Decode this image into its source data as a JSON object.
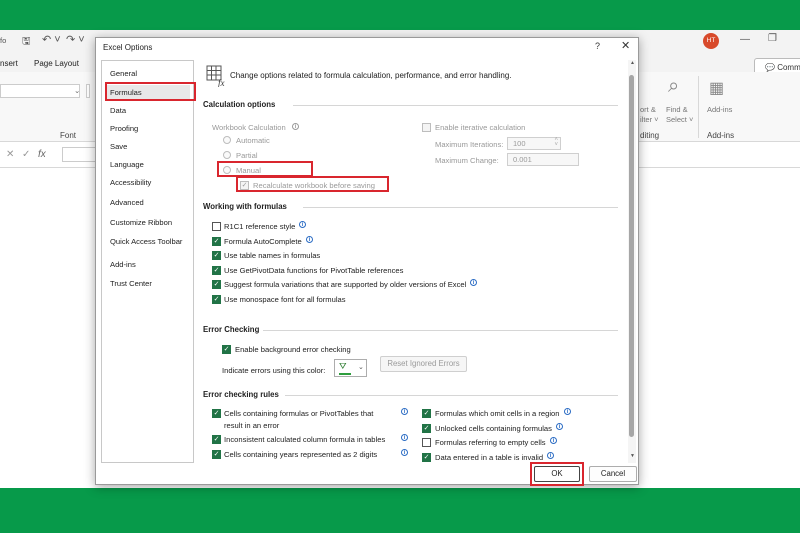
{
  "colors": {
    "band": "#079a4a",
    "highlight": "#d9262e",
    "check": "#217346",
    "avatar": "#d84a2b"
  },
  "excel": {
    "qat_left": "fo",
    "tabs": [
      "nsert",
      "Page Layout"
    ],
    "groups": {
      "font": "Font",
      "editing": "diting",
      "addins": "Add-ins"
    },
    "ribbon": {
      "sort1": "ort &",
      "sort2": "ilter",
      "find1": "Find &",
      "find2": "Select",
      "addins_btn": "Add-ins"
    },
    "avatar": "HT",
    "comments": "Comme",
    "fx": "fx"
  },
  "dialog": {
    "title": "Excel Options",
    "help": "?",
    "close": "✕",
    "nav": [
      "General",
      "Formulas",
      "Data",
      "Proofing",
      "Save",
      "Language",
      "Accessibility",
      "Advanced",
      "Customize Ribbon",
      "Quick Access Toolbar",
      "Add-ins",
      "Trust Center"
    ],
    "nav_selected": "Formulas",
    "header": "Change options related to formula calculation, performance, and error handling.",
    "calc": {
      "title": "Calculation options",
      "workbook_calc": "Workbook Calculation",
      "automatic": "Automatic",
      "partial": "Partial",
      "manual": "Manual",
      "recalc": "Recalculate workbook before saving",
      "iterative": "Enable iterative calculation",
      "max_iter_label": "Maximum Iterations:",
      "max_iter_value": "100",
      "max_change_label": "Maximum Change:",
      "max_change_value": "0.001"
    },
    "working": {
      "title": "Working with formulas",
      "items": [
        {
          "label": "R1C1 reference style",
          "checked": false,
          "info": true
        },
        {
          "label": "Formula AutoComplete",
          "checked": true,
          "info": true
        },
        {
          "label": "Use table names in formulas",
          "checked": true,
          "info": false
        },
        {
          "label": "Use GetPivotData functions for PivotTable references",
          "checked": true,
          "info": false
        },
        {
          "label": "Suggest formula variations that are supported by older versions of Excel",
          "checked": true,
          "info": true
        },
        {
          "label": "Use monospace font for all formulas",
          "checked": true,
          "info": false
        }
      ]
    },
    "error_checking": {
      "title": "Error Checking",
      "enable": "Enable background error checking",
      "indicate": "Indicate errors using this color:",
      "reset": "Reset Ignored Errors"
    },
    "rules": {
      "title": "Error checking rules",
      "left": [
        {
          "label": "Cells containing formulas or PivotTables that",
          "label2": "result in an error",
          "checked": true
        },
        {
          "label": "Inconsistent calculated column formula in tables",
          "checked": true
        },
        {
          "label": "Cells containing years represented as 2 digits",
          "checked": true
        }
      ],
      "right": [
        {
          "label": "Formulas which omit cells in a region",
          "checked": true
        },
        {
          "label": "Unlocked cells containing formulas",
          "checked": true
        },
        {
          "label": "Formulas referring to empty cells",
          "checked": false
        },
        {
          "label": "Data entered in a table is invalid",
          "checked": true
        }
      ]
    },
    "ok": "OK",
    "cancel": "Cancel"
  }
}
